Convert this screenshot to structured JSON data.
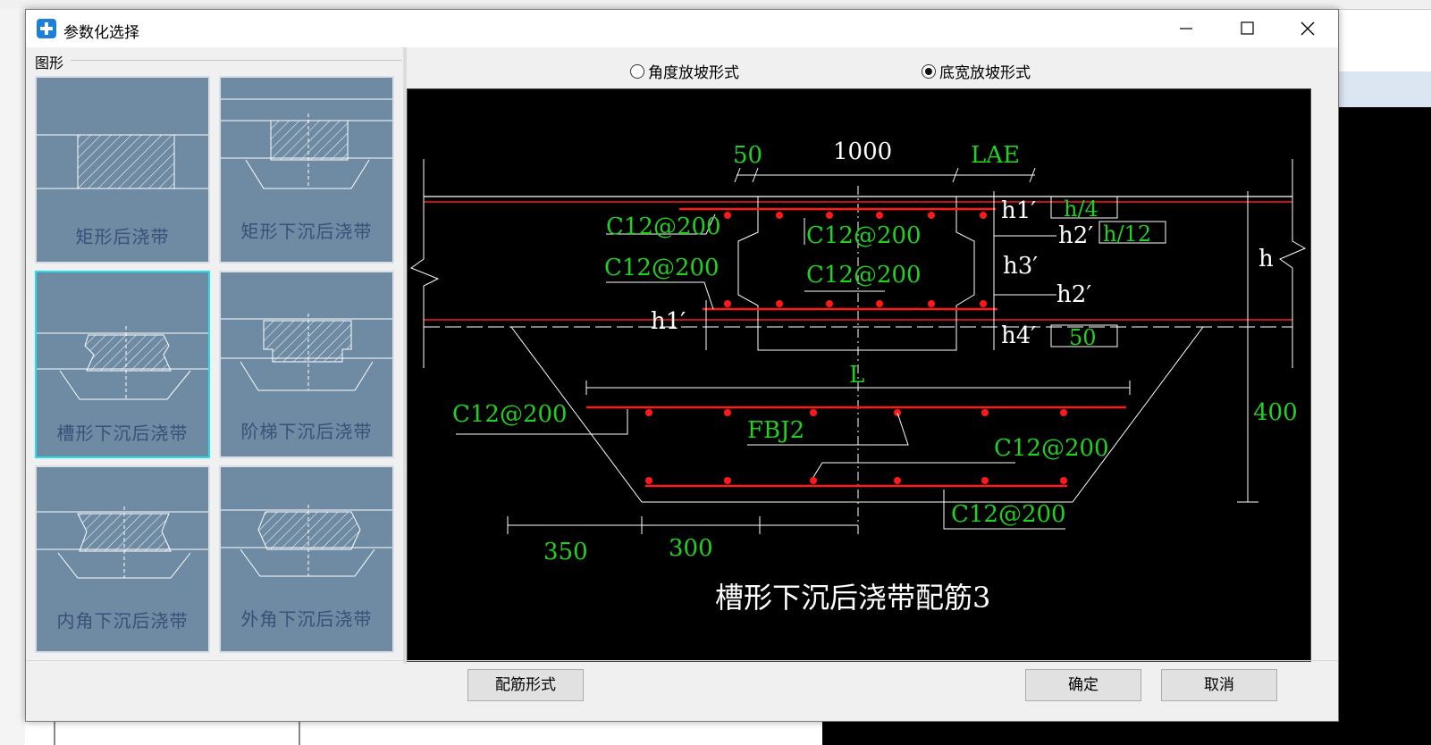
{
  "window": {
    "title": "参数化选择"
  },
  "left_panel": {
    "group_label": "图形",
    "thumbnails": [
      {
        "label": "矩形后浇带"
      },
      {
        "label": "矩形下沉后浇带"
      },
      {
        "label": "槽形下沉后浇带"
      },
      {
        "label": "阶梯下沉后浇带"
      },
      {
        "label": "内角下沉后浇带"
      },
      {
        "label": "外角下沉后浇带"
      }
    ],
    "selected_index": 2
  },
  "radio_options": [
    {
      "label": "角度放坡形式",
      "checked": false
    },
    {
      "label": "底宽放坡形式",
      "checked": true
    }
  ],
  "preview": {
    "title": "槽形下沉后浇带配筋3",
    "dims": {
      "d50_top": "50",
      "d1000": "1000",
      "lae": "LAE",
      "h1p": "h1′",
      "h4_box": "h/4",
      "h2p": "h2′",
      "h12_box": "h/12",
      "h3p": "h3′",
      "h": "h",
      "h4p": "h4′",
      "d50_box": "50",
      "L": "L",
      "d400": "400",
      "d350": "350",
      "d300": "300"
    },
    "rebar_labels": {
      "r1": "C12@200",
      "r2": "C12@200",
      "r3": "C12@200",
      "r4": "C12@200",
      "r5": "C12@200",
      "r6": "C12@200",
      "r7": "C12@200",
      "fbj": "FBJ2"
    },
    "colors": {
      "background": "#000000",
      "dim_green": "#22d022",
      "rebar_red": "#ff1a1a",
      "line_white": "#ffffff"
    }
  },
  "buttons": {
    "rebar_form": "配筋形式",
    "ok": "确定",
    "cancel": "取消"
  }
}
